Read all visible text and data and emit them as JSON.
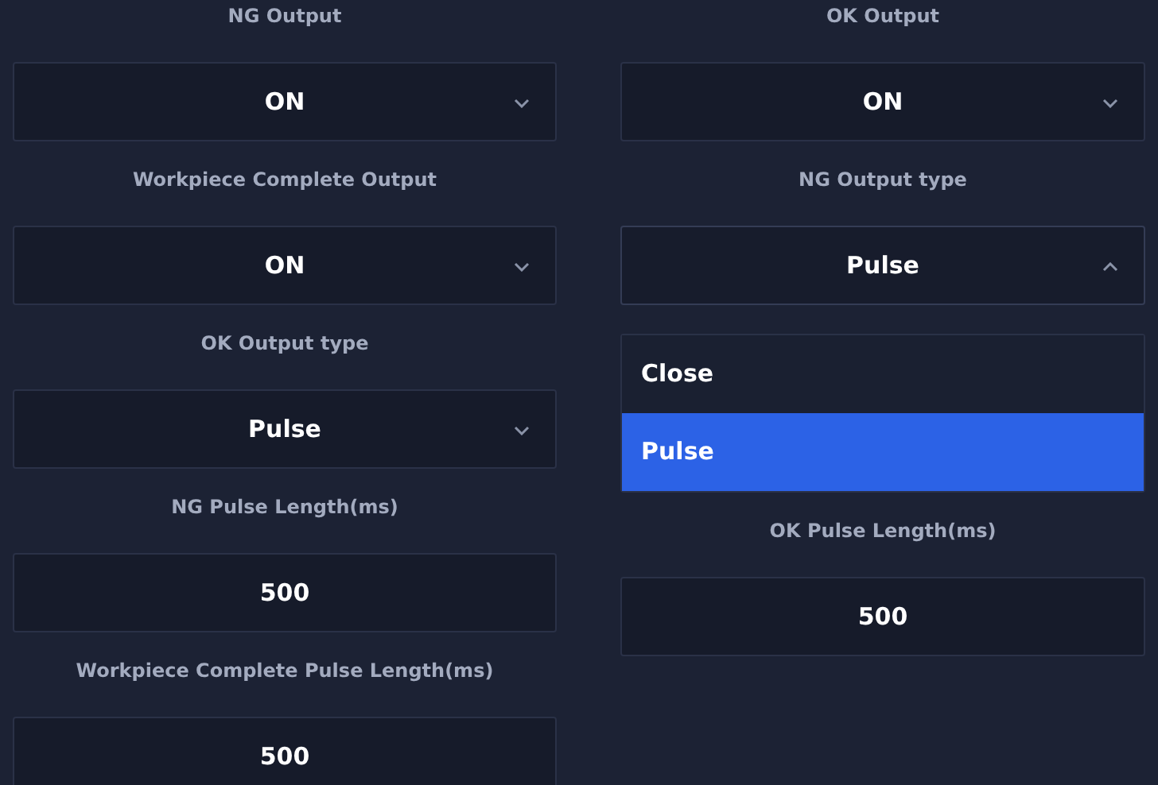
{
  "columns": [
    [
      {
        "label": "NG Output",
        "kind": "select",
        "value": "ON",
        "expanded": false
      },
      {
        "label": "Workpiece Complete Output",
        "kind": "select",
        "value": "ON",
        "expanded": false
      },
      {
        "label": "OK Output type",
        "kind": "select",
        "value": "Pulse",
        "expanded": false
      },
      {
        "label": "NG Pulse Length(ms)",
        "kind": "number",
        "value": "500"
      },
      {
        "label": "Workpiece Complete Pulse Length(ms)",
        "kind": "number",
        "value": "500"
      }
    ],
    [
      {
        "label": "OK Output",
        "kind": "select",
        "value": "ON",
        "expanded": false
      },
      {
        "label": "NG Output type",
        "kind": "select",
        "value": "Pulse",
        "expanded": true,
        "options": [
          {
            "label": "Close",
            "selected": false
          },
          {
            "label": "Pulse",
            "selected": true
          }
        ]
      },
      {
        "label": "OK Pulse Length(ms)",
        "kind": "number",
        "value": "500"
      }
    ]
  ]
}
